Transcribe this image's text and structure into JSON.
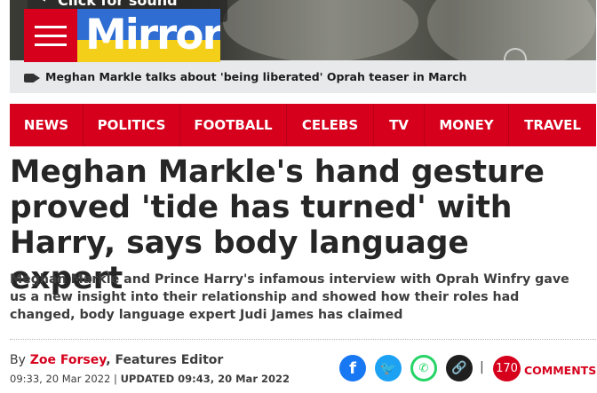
{
  "video": {
    "sound_prompt": "Click for sound",
    "caption": "Meghan Markle talks about 'being liberated' Oprah teaser in March"
  },
  "header": {
    "logo_text": "Mirror",
    "brand_colors": {
      "red": "#d6001c",
      "logo_blue": "#2f6dd2",
      "logo_yellow": "#f4cf1a"
    }
  },
  "nav": {
    "items": [
      {
        "label": "NEWS"
      },
      {
        "label": "POLITICS"
      },
      {
        "label": "FOOTBALL"
      },
      {
        "label": "CELEBS"
      },
      {
        "label": "TV"
      },
      {
        "label": "MONEY"
      },
      {
        "label": "TRAVEL"
      }
    ]
  },
  "article": {
    "headline": "Meghan Markle's hand gesture proved 'tide has turned' with Harry, says body language expert",
    "standfirst": "Meghan Markle and Prince Harry's infamous interview with Oprah Winfry gave us a new insight into their relationship and showed how their roles had changed, body language expert Judi James has claimed",
    "byline": {
      "prefix": "By",
      "author": "Zoe Forsey",
      "role": ", Features Editor"
    },
    "published": "09:33, 20 Mar 2022",
    "separator": "|",
    "updated": "UPDATED 09:43, 20 Mar 2022"
  },
  "share": {
    "icons": [
      "facebook-icon",
      "twitter-icon",
      "whatsapp-icon",
      "link-icon"
    ],
    "facebook_glyph": "f",
    "twitter_glyph": "🐦",
    "whatsapp_glyph": "✆",
    "link_glyph": "🔗",
    "pipe": "|"
  },
  "comments": {
    "count": "170",
    "label": "COMMENTS"
  }
}
